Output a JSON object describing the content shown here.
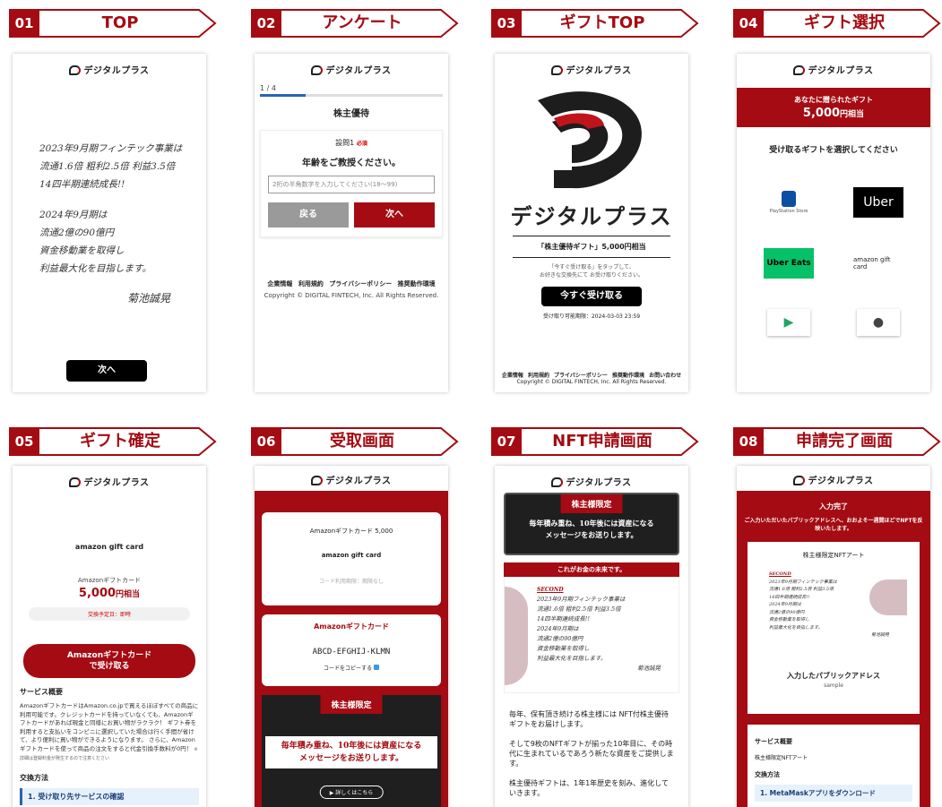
{
  "brand": "デジタルプラス",
  "colors": {
    "accent": "#a40b12",
    "black": "#000000",
    "uber_eats_green": "#06c167",
    "step_blue": "#e6f1fb"
  },
  "screens": [
    {
      "num": "01",
      "title": "TOP"
    },
    {
      "num": "02",
      "title": "アンケート"
    },
    {
      "num": "03",
      "title": "ギフトTOP"
    },
    {
      "num": "04",
      "title": "ギフト選択"
    },
    {
      "num": "05",
      "title": "ギフト確定"
    },
    {
      "num": "06",
      "title": "受取画面"
    },
    {
      "num": "07",
      "title": "NFT申請画面"
    },
    {
      "num": "08",
      "title": "申請完了画面"
    }
  ],
  "s1": {
    "para1": [
      "2023年9月期フィンテック事業は",
      "流通1.6倍 粗利2.5倍 利益3.5倍",
      "14四半期連続成長!!"
    ],
    "para2": [
      "2024年9月期は",
      "流通2億の90億円",
      "資金移動業を取得し",
      "利益最大化を目指します。"
    ],
    "signature": "菊池誠晃",
    "next": "次へ"
  },
  "s2": {
    "progress": "1 / 4",
    "title": "株主優待",
    "q_no": "設問1",
    "required": "必須",
    "question": "年齢をご教授ください。",
    "placeholder": "2桁の半角数字を入力してください(18〜99)",
    "back": "戻る",
    "next": "次へ",
    "footer_links": "企業情報 利用規約 プライバシーポリシー 推奨動作環境",
    "copyright": "Copyright © DIGITAL FINTECH, Inc. All Rights Reserved."
  },
  "s3": {
    "brand_large": "デジタルプラス",
    "subtitle": "「株主優待ギフト」5,000円相当",
    "note1": "「今すぐ受け取る」をタップして、",
    "note2": "お好きな交換先にて お受け取りください。",
    "cta": "今すぐ受け取る",
    "deadline": "受け取り可能期限：2024-03-03 23:59",
    "footer_links": "企業情報 利用規約 プライバシーポリシー 推奨動作環境 お問い合わせ",
    "copyright": "Copyright © DIGITAL FINTECH, Inc. All Rights Reserved."
  },
  "s4": {
    "gift_label": "あなたに贈られたギフト",
    "amount": "5,000",
    "amount_unit": "円相当",
    "instruction": "受け取るギフトを選択してください",
    "tiles": {
      "playstation": "PlayStation Store",
      "uber": "Uber",
      "uber_eats": "Uber Eats",
      "amazon": "amazon gift card",
      "google_play": "▶",
      "apple": ""
    }
  },
  "s5": {
    "brand": "amazon gift card",
    "card_name": "Amazonギフトカード",
    "amount": "5,000",
    "amount_unit": "円相当",
    "date": "交換予定日：即時",
    "cta_line1": "Amazonギフトカード",
    "cta_line2": "で受け取る",
    "overview_title": "サービス概要",
    "overview_body": "AmazonギフトカードはAmazon.co.jpで買えるほぼすべての商品に利用可能です。クレジットカードを持っていなくても、Amazonギフトカードがあれば現金と同様にお買い物がラクラク！ ギフト券を利用すると支払いをコンビニに選択していた場合は行く手間が省けて、より便利に買い物ができるようになります。 さらに、Amazonギフトカードを使って商品の注文をすると代金引換手数料が0円！",
    "overview_note": "※詳細は登録料金が発生するので注意ください",
    "method_title": "交換方法",
    "step1": "1. 受け取り先サービスの確認"
  },
  "s6": {
    "gift_name": "Amazonギフトカード 5,000",
    "brand": "amazon gift card",
    "code_deadline": "コード利用期限：期限なし",
    "code_title": "Amazonギフトカード",
    "code": "ABCD-EFGHIJ-KLMN",
    "copy": "コードをコピーする",
    "ribbon": "株主様限定",
    "message1": "毎年積み重ね、10年後には資産になる",
    "message2": "メッセージをお送りします。",
    "more": "▶ 詳しくはこちら"
  },
  "s7": {
    "ribbon": "株主様限定",
    "message1": "毎年積み重ね、10年後には資産になる",
    "message2": "メッセージをお送りします。",
    "band": "これがお金の未来です。",
    "card_label": "SECOND",
    "card_lines": [
      "2023年9月期フィンテック事業は",
      "流通1.6倍 粗利2.5倍 利益3.5倍",
      "14四半期連続成長!!",
      "2024年9月期は",
      "流通2億の90億円",
      "資金移動業を取得し",
      "利益最大化を目指します。",
      "菊池誠晃"
    ],
    "body": [
      "毎年、保有頂き続ける株主様には NFT付株主優待ギフトをお届けします。",
      "そして9枚のNFTギフトが揃った10年目に、その時代に生まれているであろう新たな資産をご提供します。",
      "株主優待ギフトは、1年1年歴史を刻み、進化していきます。"
    ]
  },
  "s8": {
    "done": "入力完了",
    "note": "ご入力いただいたパブリックアドレスへ、おおよそ一週間ほどでNFTを反映いたします。",
    "nft_title": "株主様限定NFTアート",
    "card_label": "SECOND",
    "card_lines": [
      "2023年9月期フィンテック事業は",
      "流通1.6倍 粗利2.5倍 利益3.5倍",
      "14四半期連続成長!!",
      "2024年9月期は",
      "流通2億の90億円",
      "資金移動業を取得し",
      "利益最大化を目指します。",
      "菊池誠晃"
    ],
    "address_label": "入力したパブリックアドレス",
    "address": "sample",
    "svc_title": "サービス概要",
    "svc_body": "株主様限定NFTアート",
    "method_title": "交換方法",
    "step1": "1. MetaMaskアプリをダウンロード"
  }
}
